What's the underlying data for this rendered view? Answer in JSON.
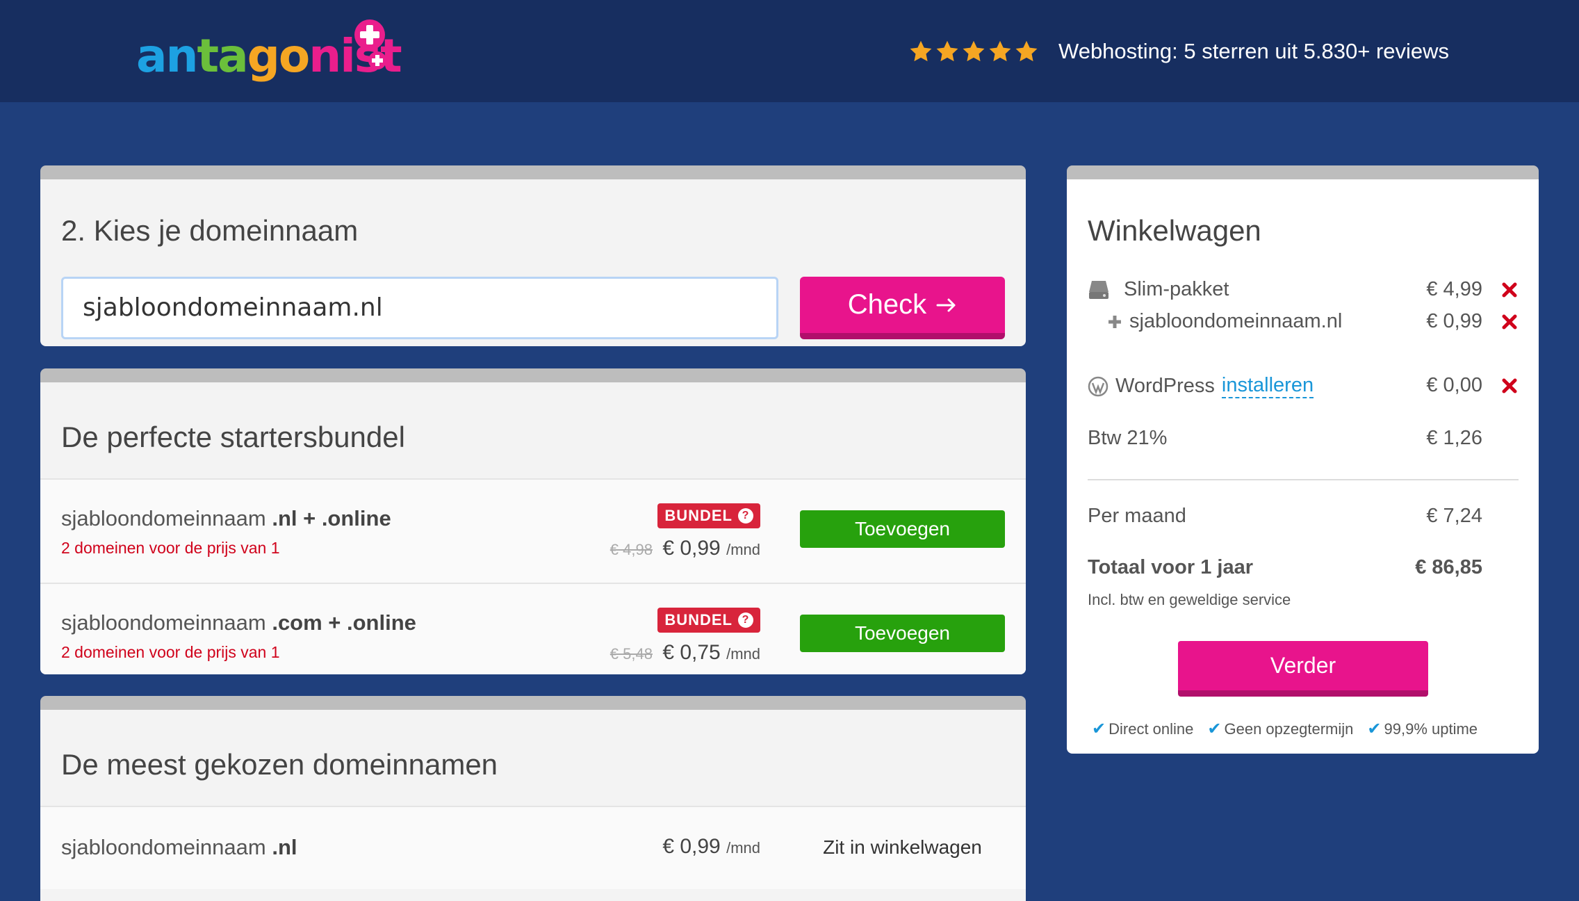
{
  "header": {
    "logo_text": "antagonist",
    "stars": 5,
    "rating_text": "Webhosting: 5 sterren uit 5.830+ reviews",
    "colors": {
      "star": "#f5a623",
      "accent": "#e8148c"
    }
  },
  "domain_search": {
    "title": "2. Kies je domeinnaam",
    "input_value": "sjabloondomeinnaam.nl",
    "check_label": "Check",
    "check_icon": "arrow-right-icon"
  },
  "bundle": {
    "title": "De perfecte startersbundel",
    "rows": [
      {
        "domain_base": "sjabloondomeinnaam",
        "tlds": ".nl + .online",
        "subtitle": "2 domeinen voor de prijs van 1",
        "badge": "BUNDEL",
        "old_price": "€ 4,98",
        "price": "€ 0,99",
        "unit": "/mnd",
        "button": "Toevoegen"
      },
      {
        "domain_base": "sjabloondomeinnaam",
        "tlds": ".com + .online",
        "subtitle": "2 domeinen voor de prijs van 1",
        "badge": "BUNDEL",
        "old_price": "€ 5,48",
        "price": "€ 0,75",
        "unit": "/mnd",
        "button": "Toevoegen"
      }
    ]
  },
  "popular": {
    "title": "De meest gekozen domeinnamen",
    "rows": [
      {
        "domain_base": "sjabloondomeinnaam",
        "tld": ".nl",
        "price": "€ 0,99",
        "unit": "/mnd",
        "status": "Zit in winkelwagen"
      }
    ]
  },
  "cart": {
    "title": "Winkelwagen",
    "items": [
      {
        "label": "Slim-pakket",
        "amount": "€ 4,99",
        "icon": "server-icon"
      },
      {
        "label": "sjabloondomeinnaam.nl",
        "amount": "€ 0,99",
        "icon": "plus-icon"
      },
      {
        "label": "WordPress",
        "link": "installeren",
        "amount": "€ 0,00",
        "icon": "wordpress-icon"
      }
    ],
    "vat_label": "Btw 21%",
    "vat_amount": "€ 1,26",
    "monthly_label": "Per maand",
    "monthly_amount": "€ 7,24",
    "total_label": "Totaal voor 1 jaar",
    "total_amount": "€ 86,85",
    "note": "Incl. btw en geweldige service",
    "continue_label": "Verder",
    "usps": [
      "Direct online",
      "Geen opzegtermijn",
      "99,9% uptime"
    ]
  }
}
